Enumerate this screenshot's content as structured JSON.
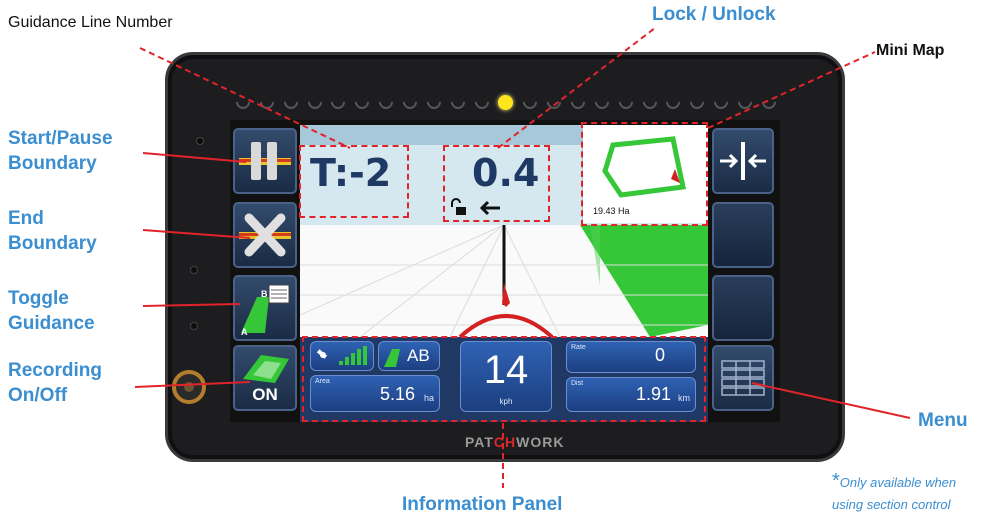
{
  "callouts": {
    "guidance_line_number": "Guidance Line Number",
    "lock_unlock": "Lock / Unlock",
    "mini_map": "Mini Map",
    "start_pause_boundary": [
      "Start/Pause",
      "Boundary"
    ],
    "end_boundary": [
      "End",
      "Boundary"
    ],
    "toggle_guidance": [
      "Toggle",
      "Guidance"
    ],
    "recording_on_off": [
      "Recording",
      "On/Off"
    ],
    "menu": "Menu",
    "information_panel": "Information Panel",
    "footnote_star": "*",
    "footnote": [
      "Only available when",
      "using section control"
    ]
  },
  "device": {
    "brand_pre": "PAT",
    "brand_ch": "CH",
    "brand_post": "WORK",
    "led_count": 23,
    "active_led": 11
  },
  "screen": {
    "track_number": "T:-2",
    "cross_track_error": "0.4",
    "mini_map_area": "19.43 Ha",
    "recording_button": "ON",
    "guidance_mode": "AB",
    "toggle_guidance_icon_labels": [
      "B",
      "A"
    ],
    "speed": {
      "value": "14",
      "unit": "kph"
    },
    "area": {
      "label": "Area",
      "value": "5.16",
      "unit": "ha"
    },
    "rate": {
      "label": "Rate",
      "value": "0"
    },
    "dist": {
      "label": "Dist",
      "value": "1.91",
      "unit": "km"
    }
  },
  "colors": {
    "callout_blue": "#3b8ed0",
    "callout_line_red": "#e0242a",
    "field_green": "#35c737",
    "panel_navy": "#1f3864",
    "led_yellow": "#ffe51b"
  }
}
